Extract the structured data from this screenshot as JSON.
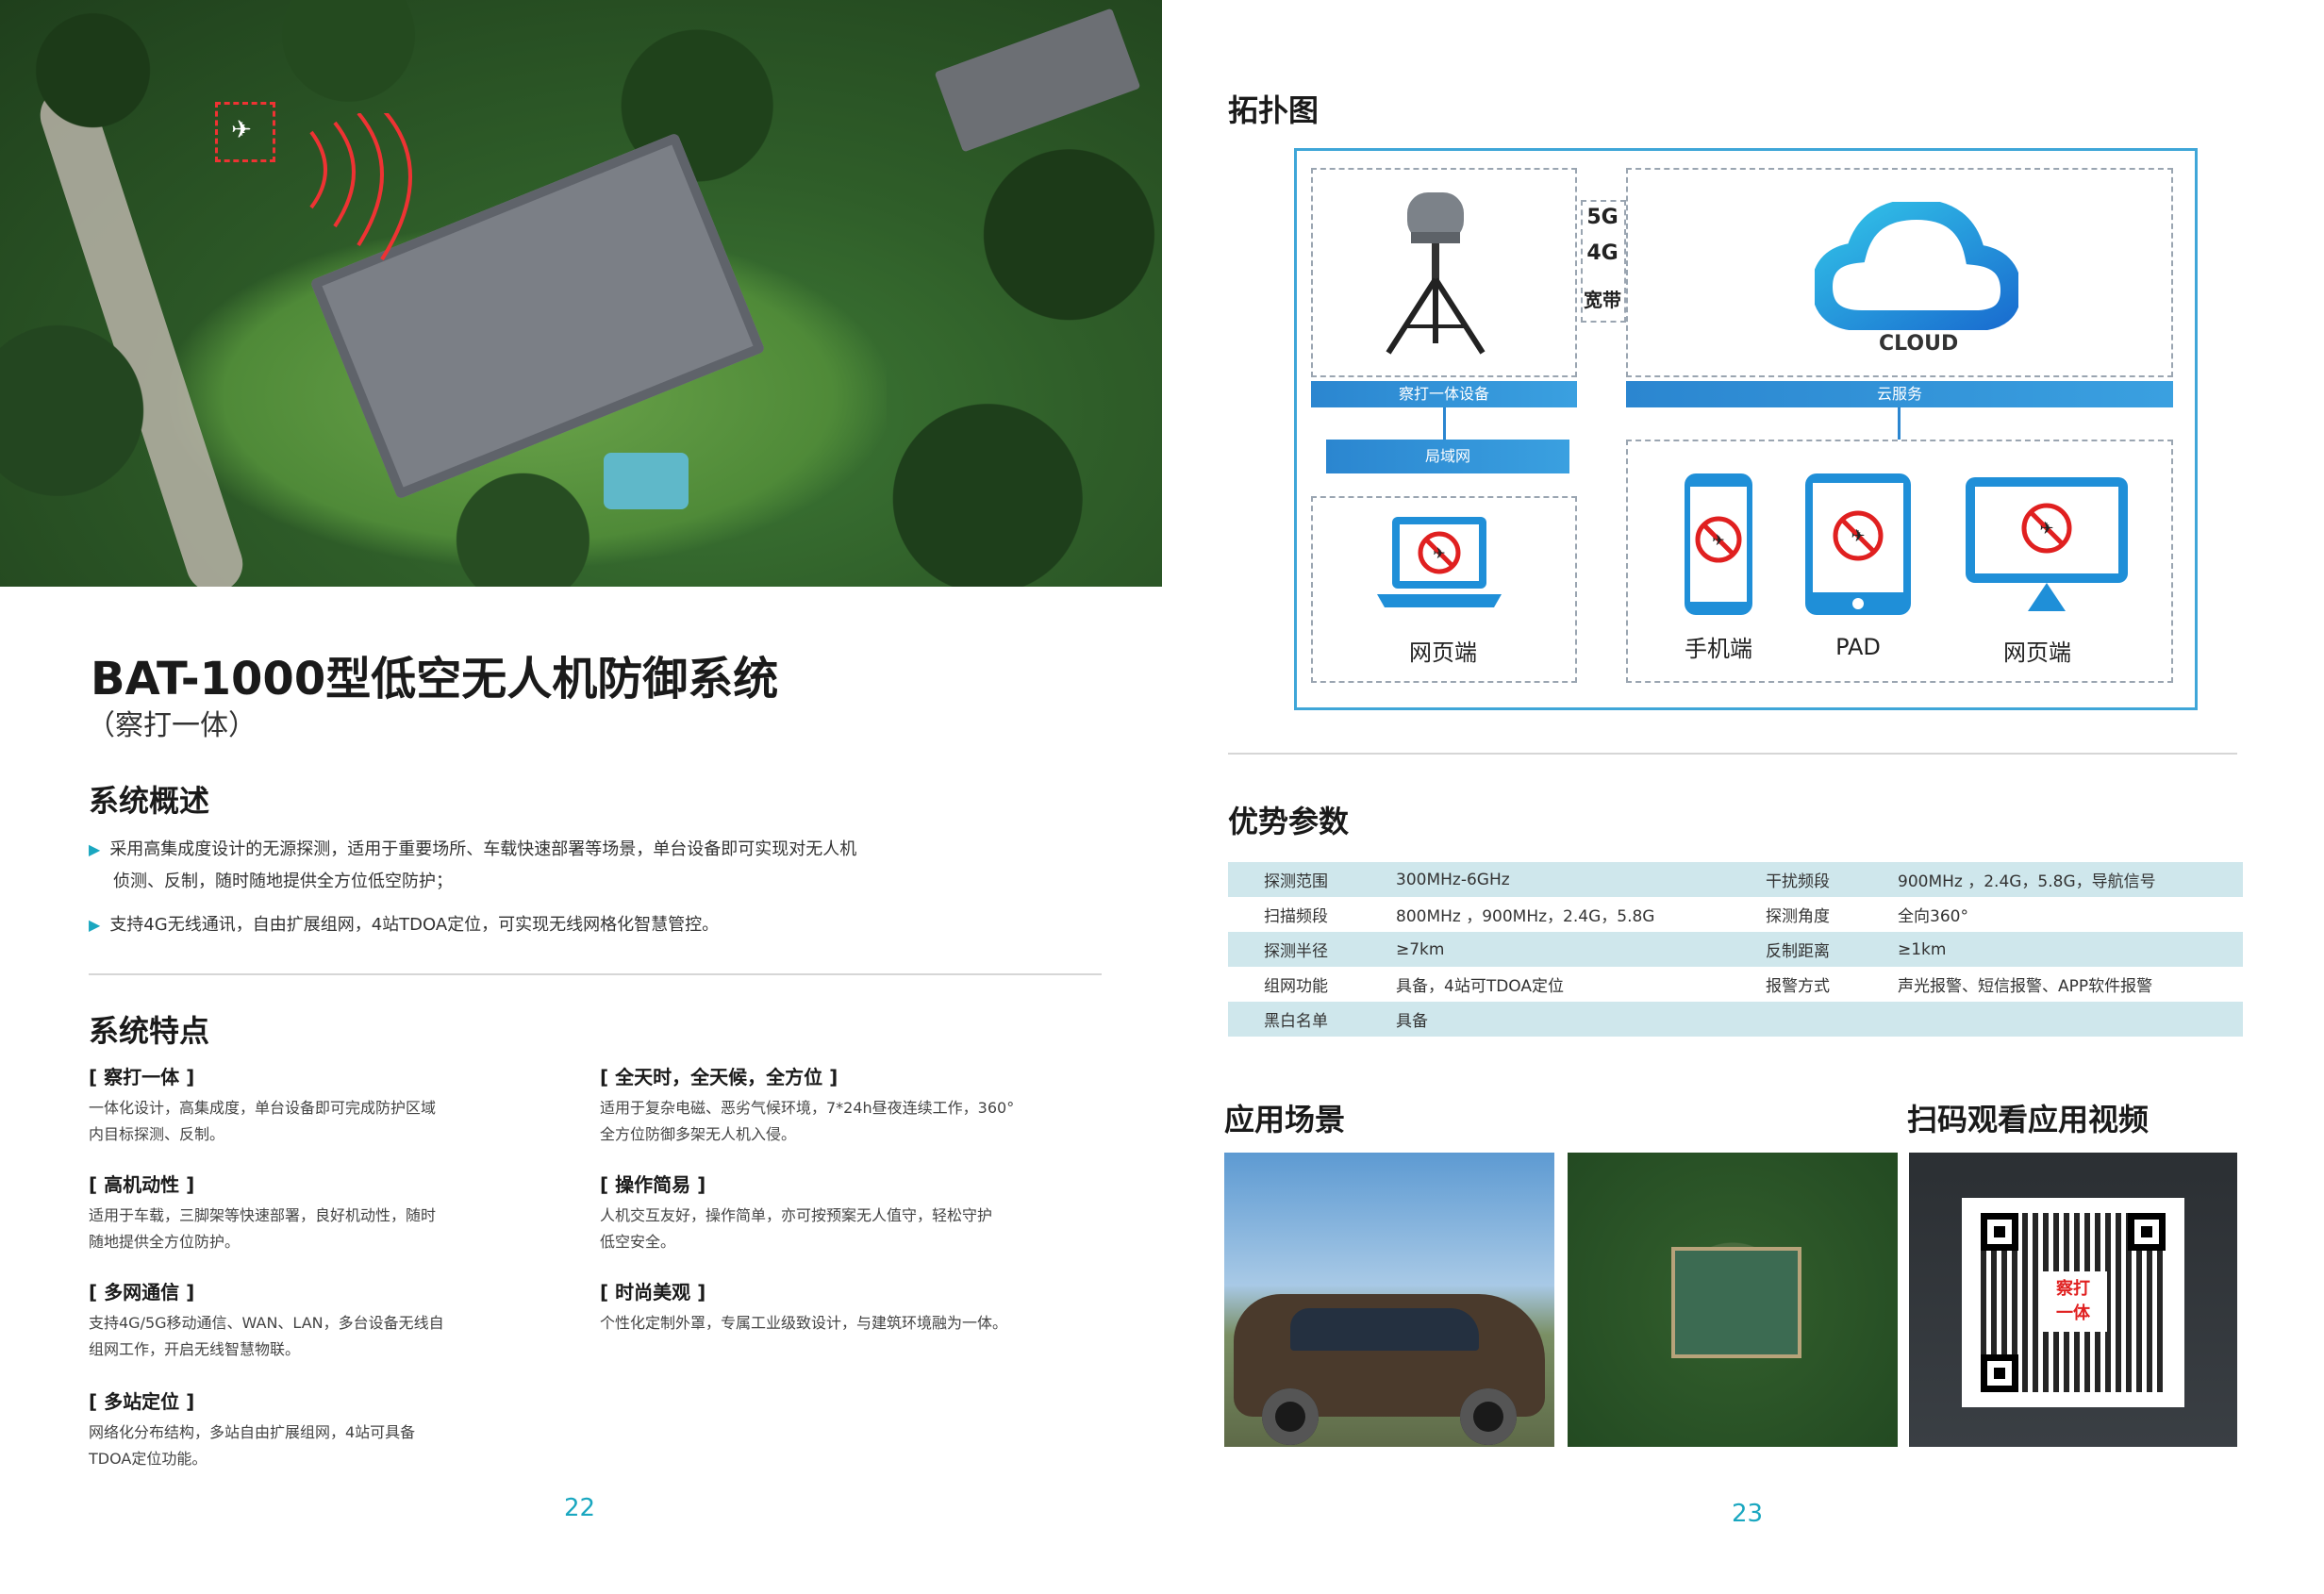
{
  "left_page": {
    "title": "BAT-1000型低空无人机防御系统",
    "subtitle": "（察打一体）",
    "overview": {
      "heading": "系统概述",
      "bullets": [
        "采用高集成度设计的无源探测，适用于重要场所、车载快速部署等场景，单台设备即可实现对无人机",
        "侦测、反制，随时随地提供全方位低空防护；",
        "支持4G无线通讯，自由扩展组网，4站TDOA定位，可实现无线网格化智慧管控。"
      ]
    },
    "features": {
      "heading": "系统特点",
      "items": [
        {
          "title": "[ 察打一体 ]",
          "lines": [
            "一体化设计，高集成度，单台设备即可完成防护区域",
            "内目标探测、反制。"
          ]
        },
        {
          "title": "[ 高机动性 ]",
          "lines": [
            "适用于车载，三脚架等快速部署，良好机动性，随时",
            "随地提供全方位防护。"
          ]
        },
        {
          "title": "[ 多网通信 ]",
          "lines": [
            "支持4G/5G移动通信、WAN、LAN，多台设备无线自",
            "组网工作，开启无线智慧物联。"
          ]
        },
        {
          "title": "[ 多站定位 ]",
          "lines": [
            "网络化分布结构，多站自由扩展组网，4站可具备",
            "TDOA定位功能。"
          ]
        },
        {
          "title": "[ 全天时，全天候，全方位 ]",
          "lines": [
            "适用于复杂电磁、恶劣气候环境，7*24h昼夜连续工作，360°",
            "全方位防御多架无人机入侵。"
          ]
        },
        {
          "title": "[ 操作简易 ]",
          "lines": [
            "人机交互友好，操作简单，亦可按预案无人值守，轻松守护",
            "低空安全。"
          ]
        },
        {
          "title": "[ 时尚美观 ]",
          "lines": [
            "个性化定制外罩，专属工业级致设计，与建筑环境融为一体。"
          ]
        }
      ]
    },
    "page_number": "22"
  },
  "right_page": {
    "topology": {
      "heading": "拓扑图",
      "networks": [
        "5G",
        "4G",
        "宽带"
      ],
      "device_bar": "察打一体设备",
      "lan_bar": "局域网",
      "cloud_bar": "云服务",
      "cloud_label": "CLOUD",
      "left_terminal": "网页端",
      "terminals": [
        "手机端",
        "PAD",
        "网页端"
      ]
    },
    "params": {
      "heading": "优势参数",
      "rows": [
        [
          "探测范围",
          "300MHz-6GHz",
          "干扰频段",
          "900MHz ，2.4G，5.8G，导航信号"
        ],
        [
          "扫描频段",
          "800MHz ，900MHz，2.4G，5.8G",
          "探测角度",
          "全向360°"
        ],
        [
          "探测半径",
          "≥7km",
          "反制距离",
          "≥1km"
        ],
        [
          "组网功能",
          "具备，4站可TDOA定位",
          "报警方式",
          "声光报警、短信报警、APP软件报警"
        ],
        [
          "黑白名单",
          "具备",
          "",
          ""
        ]
      ]
    },
    "scenes_heading": "应用场景",
    "video_heading": "扫码观看应用视频",
    "qr_center_text": [
      "察打",
      "一体"
    ],
    "page_number": "23"
  },
  "colors": {
    "accent": "#1aa7c0",
    "table_stripe": "#cfe7ec",
    "topology_border": "#3fa6d8",
    "bar_blue": "#2b86d0",
    "alert_red": "#e02020"
  }
}
